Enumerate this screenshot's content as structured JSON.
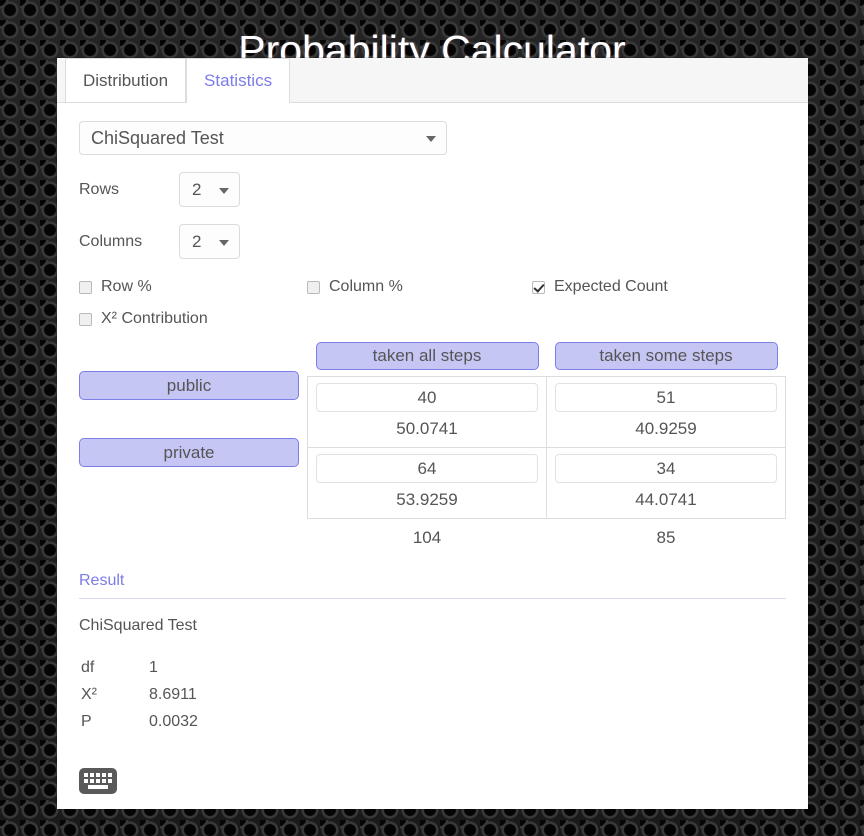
{
  "app": {
    "title": "Probability Calculator"
  },
  "tabs": [
    {
      "label": "Distribution",
      "active": false
    },
    {
      "label": "Statistics",
      "active": true
    }
  ],
  "controls": {
    "test_select": {
      "value": "ChiSquared Test",
      "arrow_icon": "chevron-down-icon"
    },
    "rows": {
      "label": "Rows",
      "value": "2"
    },
    "columns": {
      "label": "Columns",
      "value": "2"
    },
    "checkboxes": [
      {
        "label": "Row %",
        "checked": false
      },
      {
        "label": "Column %",
        "checked": false
      },
      {
        "label": "Expected Count",
        "checked": true
      },
      {
        "label": "X² Contribution",
        "checked": false
      }
    ]
  },
  "contingency": {
    "column_headers": [
      "taken all steps",
      "taken some steps"
    ],
    "row_headers": [
      "public",
      "private"
    ],
    "observed": [
      [
        40,
        51
      ],
      [
        64,
        34
      ]
    ],
    "expected": [
      [
        "50.0741",
        "40.9259"
      ],
      [
        "53.9259",
        "44.0741"
      ]
    ],
    "column_totals": [
      "104",
      "85"
    ]
  },
  "result": {
    "heading": "Result",
    "test_name": "ChiSquared Test",
    "rows": [
      {
        "key": "df",
        "value": "1"
      },
      {
        "key": "X²",
        "value": "8.6911"
      },
      {
        "key": "P",
        "value": "0.0032"
      }
    ]
  },
  "footer": {
    "keyboard_icon": "keyboard-icon"
  },
  "colors": {
    "accent": "#7b7bea",
    "button_fill": "#c6c6f5",
    "button_border": "#7e7ee8",
    "text": "#555555",
    "panel": "#ffffff"
  }
}
